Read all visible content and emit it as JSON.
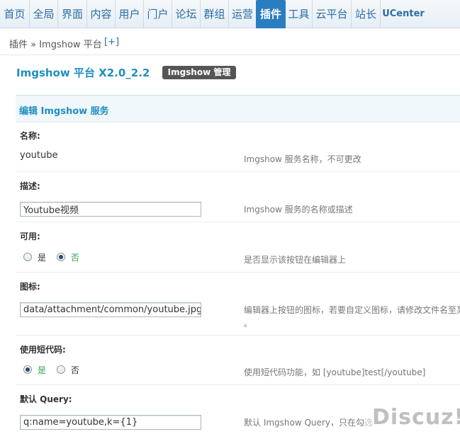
{
  "nav": [
    {
      "label": "首页"
    },
    {
      "label": "全局"
    },
    {
      "label": "界面"
    },
    {
      "label": "内容"
    },
    {
      "label": "用户"
    },
    {
      "label": "门户"
    },
    {
      "label": "论坛"
    },
    {
      "label": "群组"
    },
    {
      "label": "运营"
    },
    {
      "label": "插件",
      "active": true
    },
    {
      "label": "工具"
    },
    {
      "label": "云平台"
    },
    {
      "label": "站长"
    },
    {
      "label": "UCenter"
    }
  ],
  "breadcrumb": {
    "text": "插件 » Imgshow 平台",
    "add": "[+]"
  },
  "title": "Imgshow 平台 X2.0_2.2",
  "manage_button": "Imgshow 管理",
  "panel_title": "编辑 Imgshow 服务",
  "fields": {
    "name": {
      "label": "名称:",
      "value": "youtube",
      "desc": "Imgshow 服务名称，不可更改"
    },
    "description": {
      "label": "描述:",
      "value": "Youtube视频",
      "desc": "Imgshow 服务的名称或描述"
    },
    "enabled": {
      "label": "可用:",
      "yes": "是",
      "no": "否",
      "selected": "no",
      "desc": "是否显示该按钮在编辑器上"
    },
    "icon": {
      "label": "图标:",
      "value": "data/attachment/common/youtube.jpg",
      "desc": "编辑器上按钮的图标，若要自定义图标，请修改文件名至某",
      "desc_line2": "。"
    },
    "shortcode": {
      "label": "使用短代码:",
      "yes": "是",
      "no": "否",
      "selected": "yes",
      "desc": "使用短代码功能，如 [youtube]test[/youtube]"
    },
    "query": {
      "label": "默认 Query:",
      "value": "q:name=youtube,k={1}",
      "desc": "默认 Imgshow Query，只在勾选"
    }
  },
  "watermark": "Discuz!"
}
